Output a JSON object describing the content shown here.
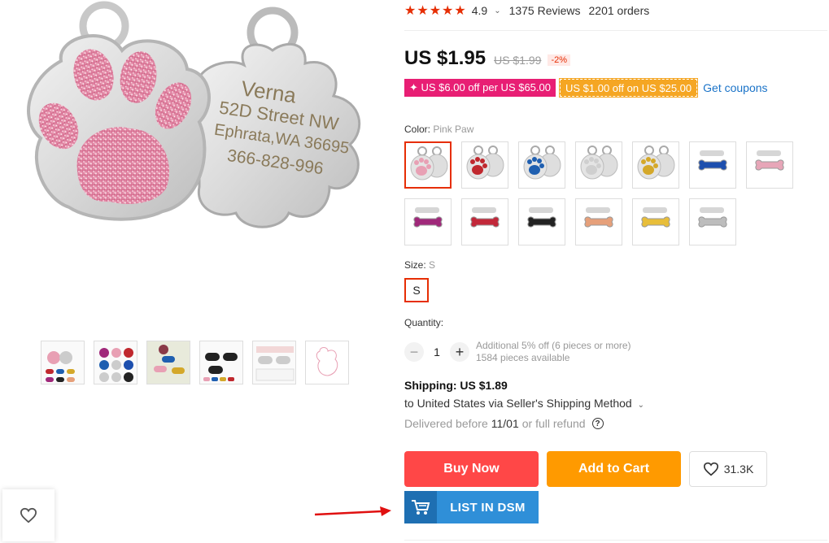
{
  "product_image": {
    "tag_lines": [
      "Verna",
      "52D Street NW",
      "Ephrata,WA 36695",
      "366-828-996"
    ]
  },
  "rating": {
    "stars": "★★★★★",
    "score": "4.9",
    "reviews": "1375 Reviews",
    "orders": "2201 orders"
  },
  "price": {
    "current": "US $1.95",
    "original": "US $1.99",
    "discount": "-2%"
  },
  "coupons": {
    "store_coupon": "✦ US $6.00 off per US $65.00",
    "select_coupon": "US $1.00 off on US $25.00",
    "get_coupons": "Get coupons"
  },
  "color": {
    "label": "Color:",
    "selected": "Pink Paw",
    "swatches": [
      {
        "name": "pink-paw",
        "color": "#e8a0b4"
      },
      {
        "name": "red-paw",
        "color": "#c0282e"
      },
      {
        "name": "blue-paw",
        "color": "#1f5fb0"
      },
      {
        "name": "silver-paw",
        "color": "#cfcfcf"
      },
      {
        "name": "gold-paw",
        "color": "#d4a82a"
      },
      {
        "name": "blue-bone-paw",
        "color": "#1d4fae"
      },
      {
        "name": "pink-bone-paw",
        "color": "#e7a6b8"
      },
      {
        "name": "purple-bone",
        "color": "#a0287a"
      },
      {
        "name": "red-bone",
        "color": "#c2283a"
      },
      {
        "name": "black-bone",
        "color": "#222222"
      },
      {
        "name": "rose-gold-bone",
        "color": "#e6a07a"
      },
      {
        "name": "gold-bone",
        "color": "#e8be3a"
      },
      {
        "name": "silver-bone",
        "color": "#bdbdbd"
      }
    ]
  },
  "size": {
    "label": "Size:",
    "selected": "S",
    "options": [
      "S"
    ]
  },
  "quantity": {
    "label": "Quantity:",
    "value": "1",
    "minus": "−",
    "plus": "+",
    "discount_note": "Additional 5% off (6 pieces or more)",
    "available": "1584 pieces available"
  },
  "shipping": {
    "cost": "Shipping: US $1.89",
    "destination": "to United States via Seller's Shipping Method",
    "delivery_prefix": "Delivered before",
    "delivery_date": "11/01",
    "delivery_suffix": "or full refund",
    "help": "?"
  },
  "actions": {
    "buy_now": "Buy Now",
    "add_to_cart": "Add to Cart",
    "wishlist_count": "31.3K",
    "list_in_dsm": "LIST IN DSM"
  },
  "colors": {
    "accent_red": "#ff4747",
    "cart_orange": "#ff9a00",
    "dsm_blue": "#2f8fd8",
    "star_red": "#e62e04",
    "coupon_pink": "#e81e74",
    "coupon_orange": "#f5a623",
    "link_blue": "#1a73c8"
  }
}
